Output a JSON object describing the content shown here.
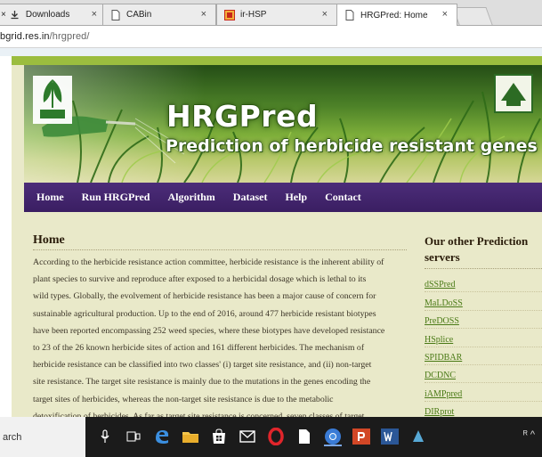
{
  "browser": {
    "tabs": [
      {
        "label": "Downloads",
        "icon": "download-icon"
      },
      {
        "label": "CABin",
        "icon": "page-icon"
      },
      {
        "label": "ir-HSP",
        "icon": "site-favicon"
      },
      {
        "label": "HRGPred: Home",
        "icon": "page-icon",
        "active": true
      }
    ],
    "close_glyph": "×",
    "address": {
      "host": "bgrid.res.in",
      "path": "/hrgpred/"
    }
  },
  "site": {
    "banner": {
      "title": "HRGPred",
      "subtitle": "Prediction of herbicide resistant genes"
    },
    "nav": [
      "Home",
      "Run HRGPred",
      "Algorithm",
      "Dataset",
      "Help",
      "Contact"
    ],
    "main": {
      "heading": "Home",
      "lines": [
        "According to the herbicide resistance action committee, herbicide resistance is the inherent ability of",
        "plant species to survive and reproduce after exposed to a herbicidal dosage which is lethal to its",
        "wild types. Globally, the evolvement of herbicide resistance has been a major cause of concern for",
        "sustainable agricultural production. Up to the end of 2016, around 477 herbicide resistant biotypes",
        "have been reported encompassing 252 weed species, where these biotypes have developed resistance",
        "to 23 of the 26 known herbicide sites of action and 161 different herbicides. The mechanism of",
        "herbicide resistance can be classified into two classes' (i) target site resistance, and (ii) non-target",
        "site resistance. The target site resistance is mainly due to the mutations in the genes encoding the",
        "target sites of herbicides, whereas the non-target site resistance is due to the metabolic",
        "detoxification of herbicides. As far as target site resistance is concerned, seven classes of target"
      ]
    },
    "sidebar": {
      "heading": "Our other Prediction servers",
      "links": [
        "dSSPred",
        "MaLDoSS",
        "PreDOSS",
        "HSplice",
        "SPIDBAR",
        "DCDNC",
        "iAMPpred",
        "DIRprot"
      ]
    }
  },
  "taskbar": {
    "search_text": "arch",
    "tray_text": "ᴿ ^"
  }
}
